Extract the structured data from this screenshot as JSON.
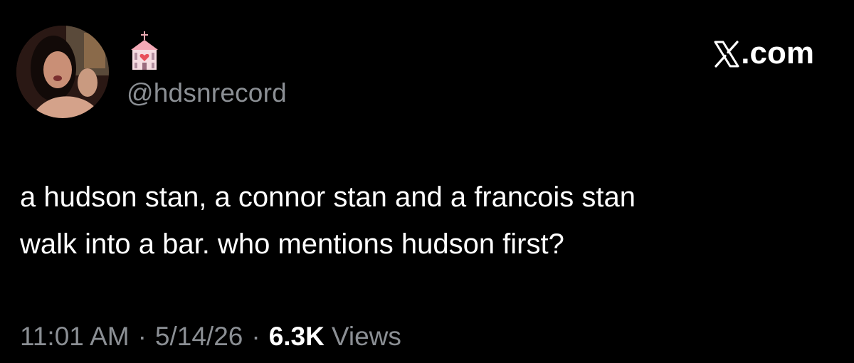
{
  "post": {
    "display_name_icon": "wedding-chapel-emoji",
    "handle": "@hdsnrecord",
    "source": ".com",
    "text": "a hudson stan, a connor stan and a francois stan\nwalk into a bar. who mentions hudson first?",
    "time": "11:01 AM",
    "date": "5/14/26",
    "separator": "·",
    "views_count": "6.3K",
    "views_label": "Views"
  },
  "colors": {
    "background": "#000000",
    "text": "#ffffff",
    "muted": "#8b8f94"
  }
}
